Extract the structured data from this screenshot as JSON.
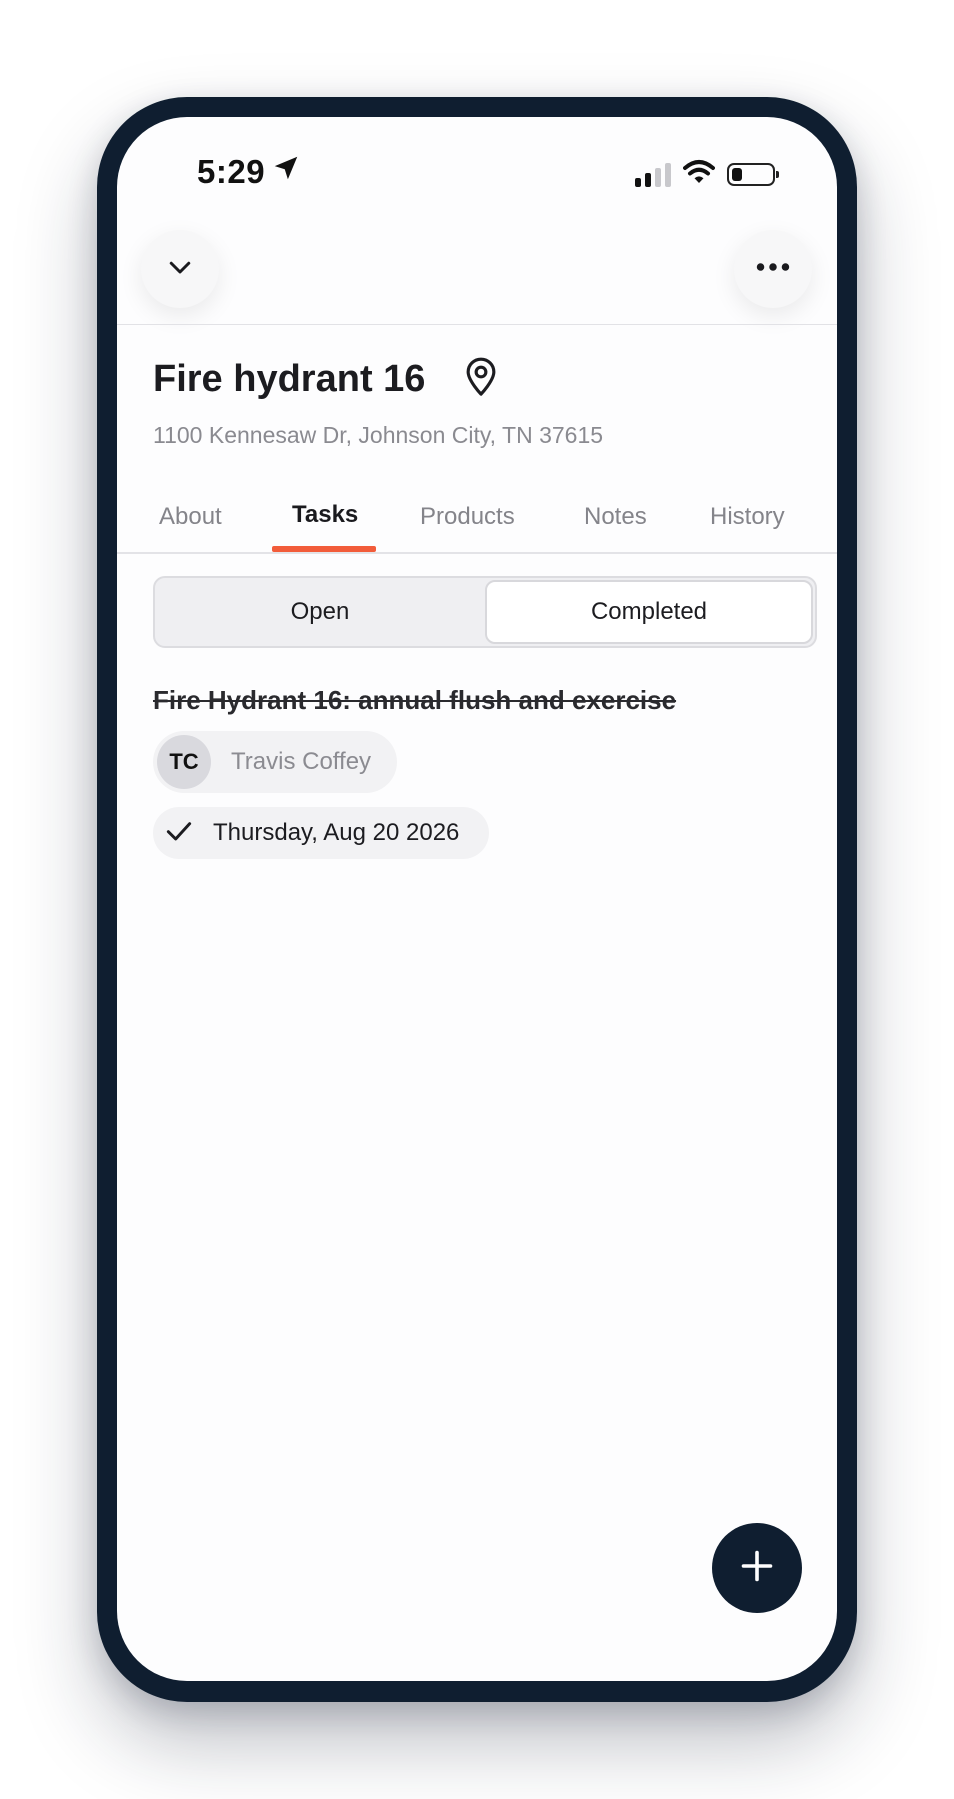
{
  "status_bar": {
    "time": "5:29",
    "location_icon": "location-arrow-icon",
    "signal_icon": "cellular-signal-icon",
    "wifi_icon": "wifi-icon",
    "battery_icon": "battery-icon",
    "battery_level": 0.25
  },
  "nav": {
    "back_icon": "chevron-down-icon",
    "more_icon": "more-horizontal-icon"
  },
  "header": {
    "title": "Fire hydrant 16",
    "pin_icon": "map-pin-icon",
    "address": "1100 Kennesaw Dr, Johnson City, TN 37615"
  },
  "tabs": [
    {
      "label": "About",
      "active": false
    },
    {
      "label": "Tasks",
      "active": true
    },
    {
      "label": "Products",
      "active": false
    },
    {
      "label": "Notes",
      "active": false
    },
    {
      "label": "History",
      "active": false
    }
  ],
  "segment": {
    "open_label": "Open",
    "completed_label": "Completed",
    "selected": "Completed"
  },
  "tasks": [
    {
      "title": "Fire Hydrant 16: annual flush and exercise",
      "completed": true,
      "assignee": {
        "initials": "TC",
        "name": "Travis Coffey"
      },
      "completed_date": "Thursday, Aug 20 2026",
      "check_icon": "checkmark-icon"
    }
  ],
  "fab": {
    "icon": "plus-icon"
  },
  "colors": {
    "frame": "#0f1e30",
    "accent": "#f25c3a",
    "muted_text": "#8a8a90"
  }
}
